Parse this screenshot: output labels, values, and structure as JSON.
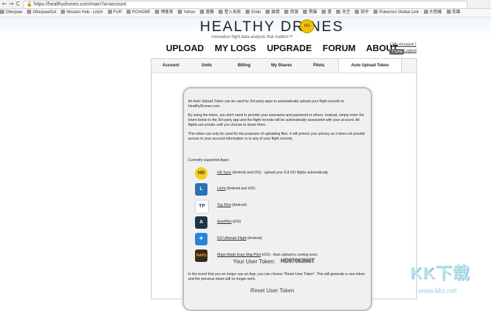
{
  "browser": {
    "back": "←",
    "forward": "→",
    "reload": "C",
    "url": "https://healthydrones.com/main?a=account"
  },
  "bookmarks": [
    "Otterpaw",
    "OtterpawOut",
    "Mission Hub - Litchi",
    "FUR",
    "PCHOME",
    "博客來",
    "Yahoo",
    "書籤",
    "登入系統",
    "Endo",
    "論壇",
    "資源",
    "黑貓",
    "書",
    "天空",
    "知乎",
    "Pokemon Global Link",
    "大陸機",
    "花園"
  ],
  "site": {
    "logo": "HEALTHY  DR    NES",
    "logo_drone_text": "HD",
    "tagline": "innovative flight data analysis that matters™",
    "nav": [
      "UPLOAD",
      "MY LOGS",
      "UPGRADE",
      "FORUM",
      "ABOUT"
    ],
    "account_link": "[ My Account ]",
    "lang": "T Lang",
    "logout": "Logout"
  },
  "tabs": [
    "Account",
    "Units",
    "Billing",
    "My Shares",
    "Pilots",
    "Auto Upload Token"
  ],
  "card": {
    "p1": "An Auto Upload Token can be used by 3rd party apps to automatically upload your flight records to HealthyDrones.com.",
    "p2": "By using the token, you don't need to provide your username and password to others. Instead, simply enter the token below in the 3rd party app and the flight records will be automatically associated with your account. All flights are private until you choose to share them.",
    "p3": "This token can only be used for the purposes of uploading files. It will protect your privacy as it does not provide access to your account information or to any of your flight records.",
    "apps_title": "Currently supported Apps:",
    "apps": [
      {
        "icon": "hd-sync-icon",
        "name": "HD Sync",
        "desc": " (Android and iOS) - upload your DJI GO flights automatically"
      },
      {
        "icon": "litchi-icon",
        "name": "Litchi",
        "desc": " (Android and iOS)"
      },
      {
        "icon": "top-pilot-icon",
        "name": "Top Pilot",
        "desc": " (Android)"
      },
      {
        "icon": "autopilot-icon",
        "name": "AutoPilot",
        "desc": " (iOS)"
      },
      {
        "icon": "dji-ultimate-flight-icon",
        "name": "DJI Ultimate Flight",
        "desc": " (Android)"
      },
      {
        "icon": "maps-made-easy-icon",
        "name": "Maps Made Easy Map Pilot",
        "desc": " (iOS) - Auto upload is coming soon"
      }
    ],
    "token_label": "Your User Token:",
    "token_value": "HD97063N6T",
    "reset_text": "In the event that you no longer use an App, you can choose \"Reset User Token\". This will generate a new token and the previous token will no longer work.",
    "reset_button": "Reset User Token"
  },
  "watermark": {
    "text": "KK下载",
    "url": "www.kkx.net"
  }
}
